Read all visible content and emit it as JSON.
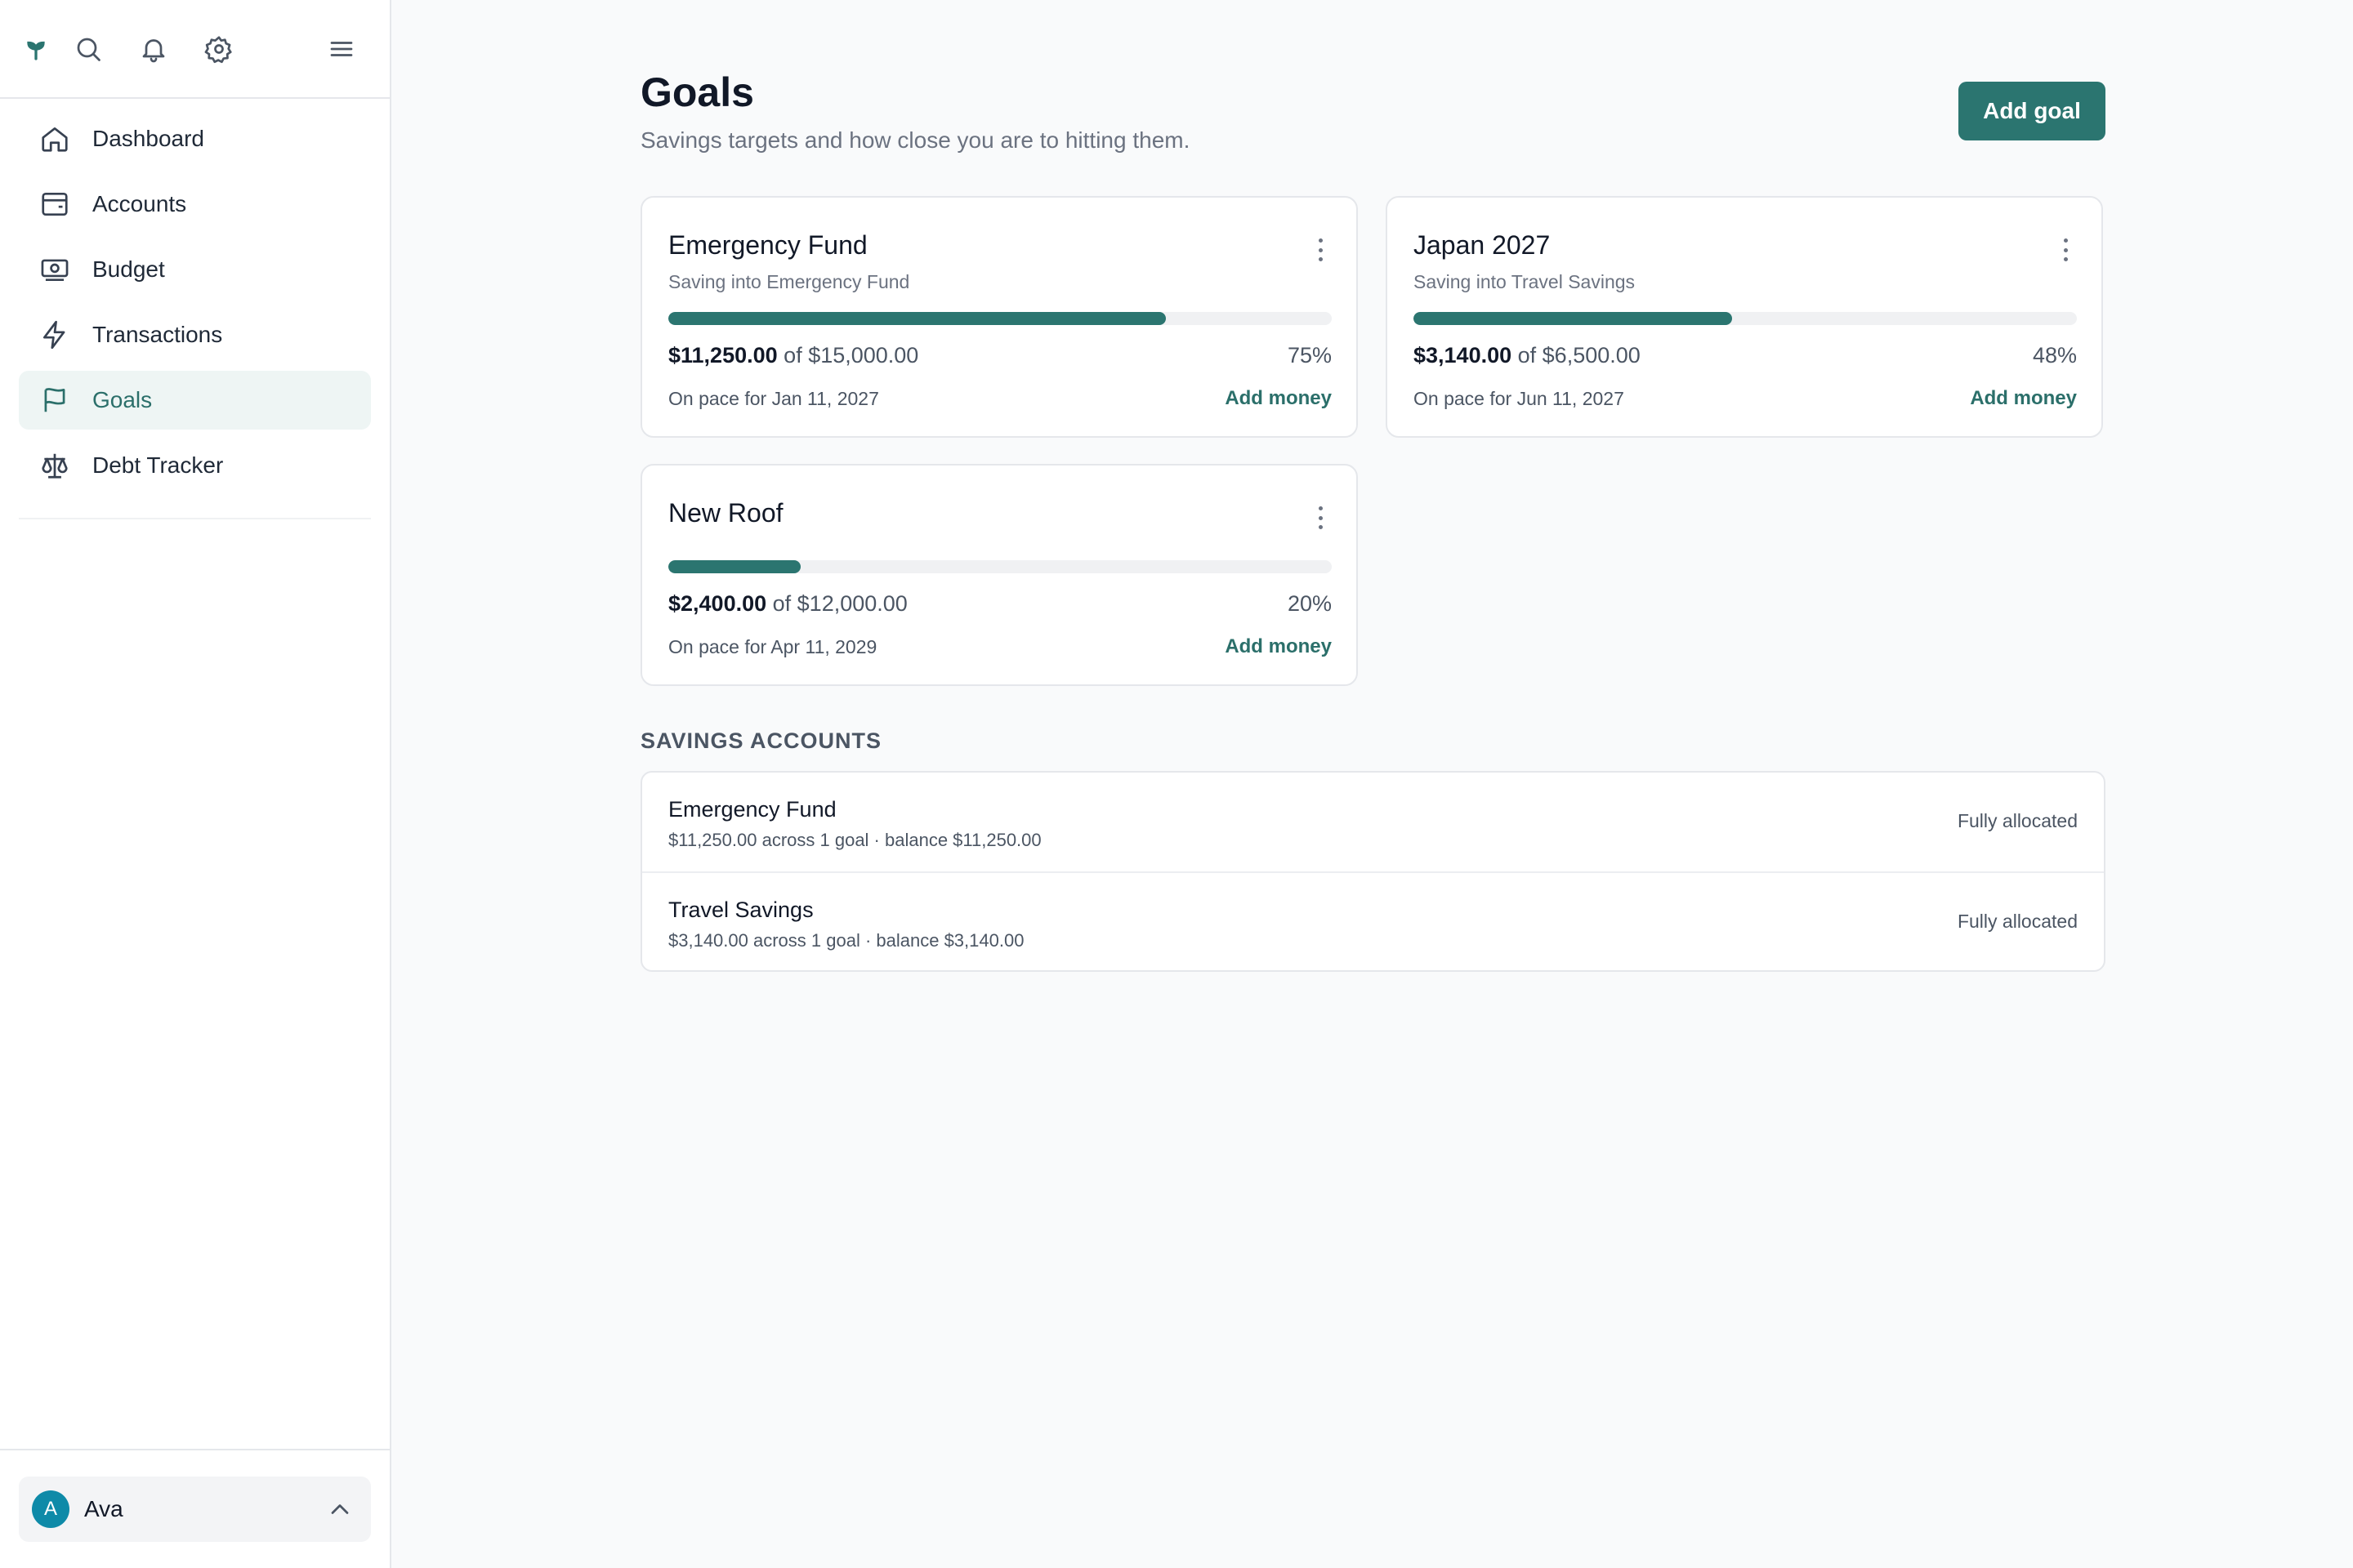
{
  "sidebar": {
    "top_icons": [
      "sprout-logo-icon",
      "search-icon",
      "bell-icon",
      "gear-icon",
      "menu-icon"
    ],
    "items": [
      {
        "label": "Dashboard",
        "icon": "home-icon"
      },
      {
        "label": "Accounts",
        "icon": "wallet-icon"
      },
      {
        "label": "Budget",
        "icon": "banknote-icon"
      },
      {
        "label": "Transactions",
        "icon": "lightning-icon"
      },
      {
        "label": "Goals",
        "icon": "flag-icon",
        "active": true
      },
      {
        "label": "Debt Tracker",
        "icon": "scale-icon"
      }
    ],
    "user": {
      "initial": "A",
      "name": "Ava"
    }
  },
  "header": {
    "title": "Goals",
    "subtitle": "Savings targets and how close you are to hitting them.",
    "add_goal_label": "Add goal"
  },
  "goals": [
    {
      "name": "Emergency Fund",
      "subtitle": "Saving into Emergency Fund",
      "current": "$11,250.00",
      "of_target": "of $15,000.00",
      "percent": "75%",
      "progress": 0.75,
      "pace": "On pace for Jan 11, 2027",
      "action": "Add money"
    },
    {
      "name": "Japan 2027",
      "subtitle": "Saving into Travel Savings",
      "current": "$3,140.00",
      "of_target": "of $6,500.00",
      "percent": "48%",
      "progress": 0.48,
      "pace": "On pace for Jun 11, 2027",
      "action": "Add money"
    },
    {
      "name": "New Roof",
      "subtitle": "",
      "current": "$2,400.00",
      "of_target": "of $12,000.00",
      "percent": "20%",
      "progress": 0.2,
      "pace": "On pace for Apr 11, 2029",
      "action": "Add money"
    }
  ],
  "savings": {
    "title": "SAVINGS ACCOUNTS",
    "accounts": [
      {
        "name": "Emergency Fund",
        "detail": "$11,250.00 across 1 goal · balance $11,250.00",
        "status": "Fully allocated"
      },
      {
        "name": "Travel Savings",
        "detail": "$3,140.00 across 1 goal · balance $3,140.00",
        "status": "Fully allocated"
      }
    ]
  },
  "colors": {
    "accent": "#2b7570",
    "active_bg": "#eef5f4",
    "avatar": "#0e8aa8"
  }
}
